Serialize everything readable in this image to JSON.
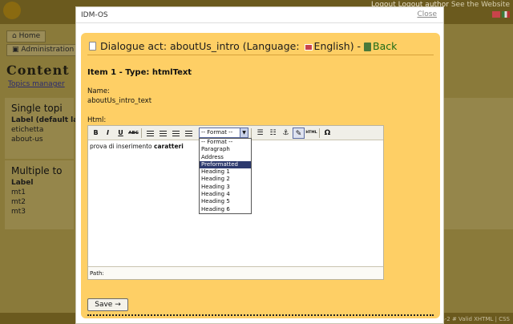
{
  "background": {
    "top_right_text": "See the Website",
    "top_links": "Logout  Logout  author",
    "tabs": [
      "Home",
      "Administration"
    ],
    "content_title": "Content",
    "topics_manager": "Topics manager",
    "single_title": "Single topi",
    "single_rows": [
      "Label (default la",
      "etichetta",
      "about-us"
    ],
    "multiple_title": "Multiple to",
    "multiple_rows": [
      "Label",
      "mt1",
      "mt2",
      "mt3"
    ],
    "valid_text": "S-2 # Valid XHTML | CSS"
  },
  "modal": {
    "title": "IDM-OS",
    "close_label": "Close"
  },
  "dialog": {
    "title_prefix": "Dialogue act: aboutUs_intro (Language:",
    "language": "English",
    "title_suffix": ") -",
    "back_label": "Back",
    "item_heading": "Item 1 - Type: htmlText",
    "name_label": "Name:",
    "name_value": "aboutUs_intro_text",
    "html_label": "Html:",
    "save_label": "Save"
  },
  "editor": {
    "toolbar": {
      "bold": "B",
      "italic": "I",
      "underline": "U",
      "strike": "ABC",
      "format_selected": "-- Format --",
      "html_button": "HTML",
      "omega": "Ω"
    },
    "content_plain": "prova di inserimento ",
    "content_bold": "caratteri",
    "format_options": [
      "-- Format --",
      "Paragraph",
      "Address",
      "Preformatted",
      "Heading 1",
      "Heading 2",
      "Heading 3",
      "Heading 4",
      "Heading 5",
      "Heading 6"
    ],
    "format_highlighted": "Preformatted",
    "path_label": "Path:"
  },
  "colors": {
    "modal_body": "#fecf65",
    "accent_back": "#1d6b17",
    "dropdown_highlight": "#2d3a6e"
  }
}
